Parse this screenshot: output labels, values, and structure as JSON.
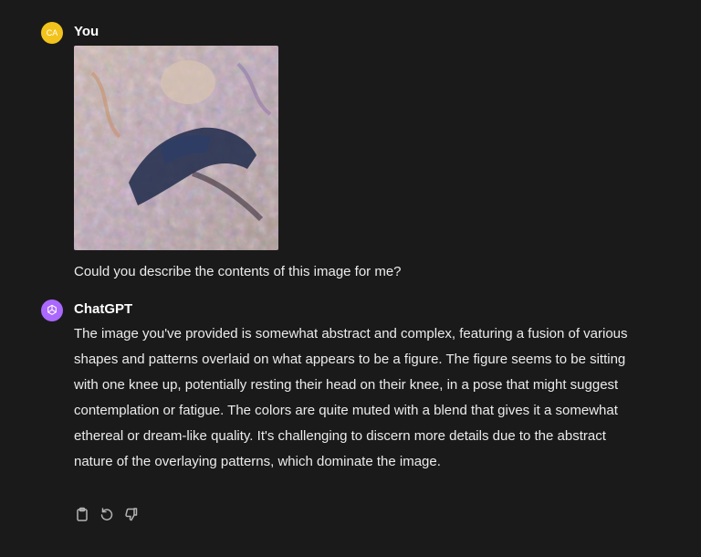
{
  "user": {
    "initials": "CA",
    "name": "You",
    "avatar_color": "#f2c31c",
    "message": "Could you describe the contents of this image for me?"
  },
  "assistant": {
    "name": "ChatGPT",
    "avatar_color": "#ab68ff",
    "avatar_icon": "openai-logo-icon",
    "message": "The image you've provided is somewhat abstract and complex, featuring a fusion of various shapes and patterns overlaid on what appears to be a figure. The figure seems to be sitting with one knee up, potentially resting their head on their knee, in a pose that might suggest contemplation or fatigue. The colors are quite muted with a blend that gives it a somewhat ethereal or dream-like quality. It's challenging to discern more details due to the abstract nature of the overlaying patterns, which dominate the image."
  },
  "actions": [
    {
      "icon": "copy-icon"
    },
    {
      "icon": "regenerate-icon"
    },
    {
      "icon": "thumbs-down-icon"
    }
  ],
  "colors": {
    "background": "#1a1a1a",
    "text": "#ececec",
    "icon": "#b4b4b4"
  }
}
